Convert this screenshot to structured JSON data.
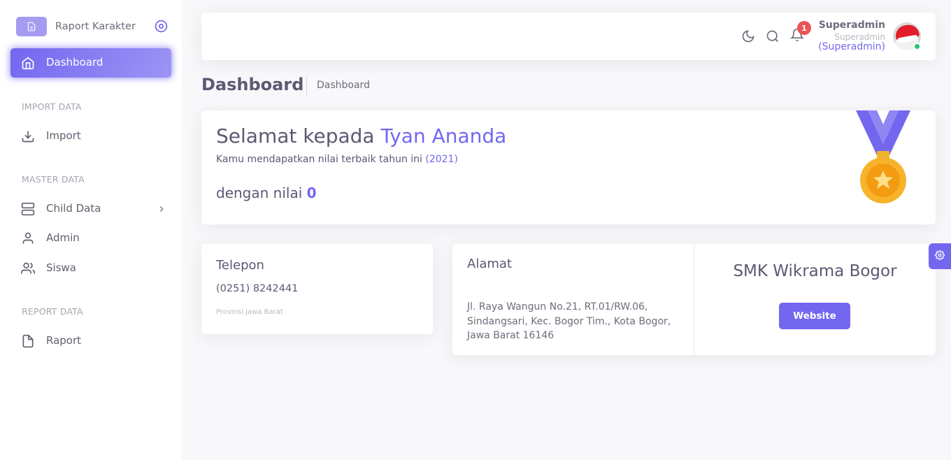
{
  "brand": {
    "title": "Raport Karakter",
    "logo_icon": "file-text-icon",
    "toggle_icon": "disc-icon"
  },
  "sidebar": {
    "active": {
      "label": "Dashboard",
      "icon": "home-icon"
    },
    "sections": [
      {
        "header": "IMPORT DATA",
        "items": [
          {
            "label": "Import",
            "icon": "download-icon"
          }
        ]
      },
      {
        "header": "MASTER DATA",
        "items": [
          {
            "label": "Child Data",
            "icon": "server-icon"
          },
          {
            "label": "Admin",
            "icon": "user-icon"
          },
          {
            "label": "Siswa",
            "icon": "users-icon"
          }
        ]
      },
      {
        "header": "REPORT DATA",
        "items": [
          {
            "label": "Raport",
            "icon": "file-icon"
          }
        ]
      }
    ]
  },
  "navbar": {
    "notification_count": "1",
    "user": {
      "name": "Superadmin",
      "role": "Superadmin",
      "role_badge": "(Superadmin)"
    }
  },
  "breadcrumb": {
    "title": "Dashboard",
    "item": "Dashboard"
  },
  "congrats": {
    "greeting": "Selamat kepada",
    "name": "Tyan Ananda",
    "subtitle": "Kamu mendapatkan nilai terbaik tahun ini",
    "year": "(2021)",
    "score_label": "dengan nilai",
    "score": "0"
  },
  "contact": {
    "phone_title": "Telepon",
    "phone": "(0251) 8242441",
    "province": "Provinsi Jawa Barat",
    "address_title": "Alamat",
    "address": "Jl. Raya Wangun No.21, RT.01/RW.06, Sindangsari, Kec. Bogor Tim., Kota Bogor, Jawa Barat 16146",
    "school": "SMK Wikrama Bogor",
    "website_label": "Website"
  },
  "colors": {
    "primary": "#7367f0",
    "danger": "#ea5455",
    "success": "#28c76f",
    "medal": "#f5a623"
  }
}
